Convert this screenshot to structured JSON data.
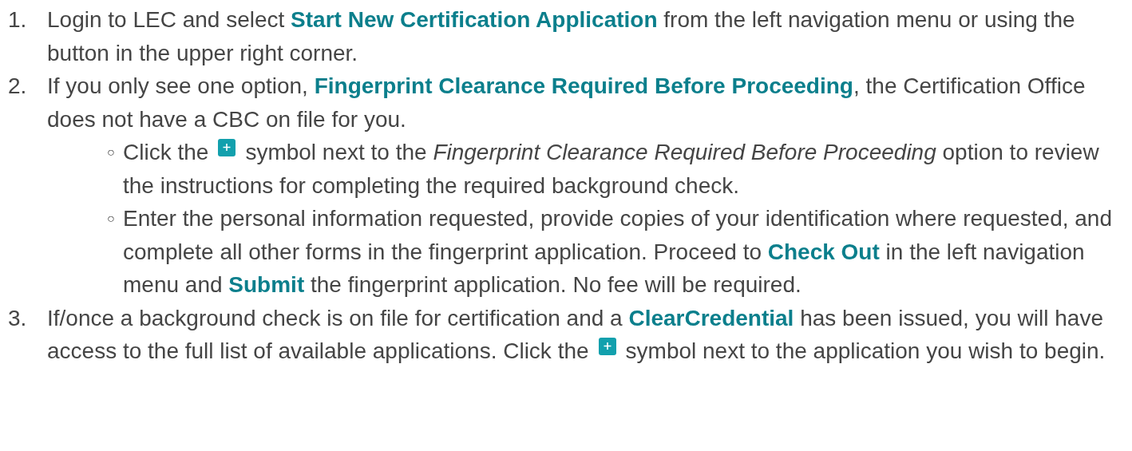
{
  "steps": [
    {
      "number": "1.",
      "parts": [
        {
          "kind": "text",
          "text": "Login to LEC and select **Start New Certification Application** from the left navigation menu or using the button in the upper right corner."
        }
      ]
    },
    {
      "number": "2.",
      "parts": [
        {
          "kind": "text",
          "text": "If you only see one option, **Fingerprint Clearance Required Before Proceeding**, the Certification Office does not have a CBC on file for you."
        }
      ],
      "substeps": [
        {
          "marker": "○",
          "parts": [
            {
              "kind": "text",
              "text": "Click the"
            },
            {
              "kind": "icon"
            },
            {
              "kind": "text",
              "text": "symbol next to the *Fingerprint Clearance Required Before Proceeding* option to review the instructions for completing the required background check."
            }
          ]
        },
        {
          "marker": "○",
          "parts": [
            {
              "kind": "text",
              "text": "Enter the personal information requested, provide copies of your identification where requested, and complete all other forms in the fingerprint application. Proceed to **Check Out** in the left navigation menu and **Submit** the fingerprint application. No fee will be required."
            }
          ]
        }
      ]
    },
    {
      "number": "3.",
      "parts": [
        {
          "kind": "text",
          "text": "If/once a background check is on file for certification and a **ClearCredential** has been issued, you will have access to the full list of available applications. Click the"
        },
        {
          "kind": "icon"
        },
        {
          "kind": "text",
          "text": "symbol next to the application you wish to begin."
        }
      ]
    }
  ]
}
